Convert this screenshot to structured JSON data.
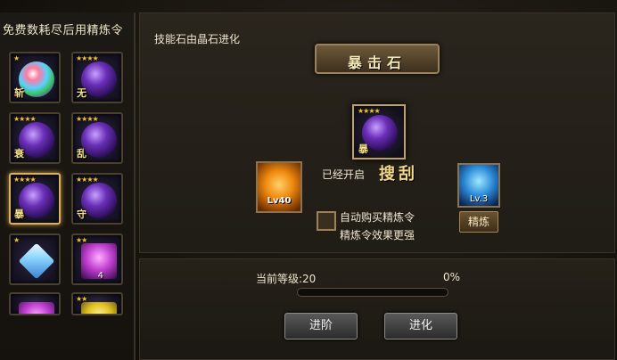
{
  "left_panel": {
    "title": "免费数耗尽后用精炼令",
    "items": [
      {
        "stars": "★",
        "tag": "斩",
        "gem": "rainbow",
        "selected": false
      },
      {
        "stars": "★★★★",
        "tag": "无",
        "gem": "purple",
        "selected": false
      },
      {
        "stars": "★★★★",
        "tag": "衰",
        "gem": "purple",
        "selected": false
      },
      {
        "stars": "★★★★",
        "tag": "乱",
        "gem": "purple",
        "selected": false
      },
      {
        "stars": "★★★★",
        "tag": "暴",
        "gem": "purple",
        "selected": true
      },
      {
        "stars": "★★★★",
        "tag": "守",
        "gem": "purple",
        "selected": false
      },
      {
        "stars": "★",
        "tag": "",
        "gem": "diamond",
        "selected": false
      },
      {
        "stars": "★★",
        "tag": "",
        "gem": "crystal",
        "count": "4",
        "selected": false
      },
      {
        "stars": "",
        "tag": "",
        "gem": "crystal",
        "selected": false
      },
      {
        "stars": "★★",
        "tag": "",
        "gem": "yellow",
        "selected": false
      }
    ]
  },
  "top_panel": {
    "info": "技能石由晶石进化",
    "title": "暴击石",
    "main_slot": {
      "stars": "★★★★",
      "tag": "暴"
    },
    "left_slot": {
      "level": "Lv40"
    },
    "open_label": "已经开启",
    "open_name": "搜刮",
    "right_slot": {
      "level": "Lv.3"
    },
    "refine_label": "精炼",
    "checkbox_line1": "自动购买精炼令",
    "checkbox_line2": "精炼令效果更强"
  },
  "bottom_panel": {
    "level_text": "当前等级:20",
    "percent_text": "0%",
    "progress": 0,
    "advance_label": "进阶",
    "evolve_label": "进化"
  },
  "colors": {
    "accent": "#d8b060",
    "star": "#f2c230"
  }
}
